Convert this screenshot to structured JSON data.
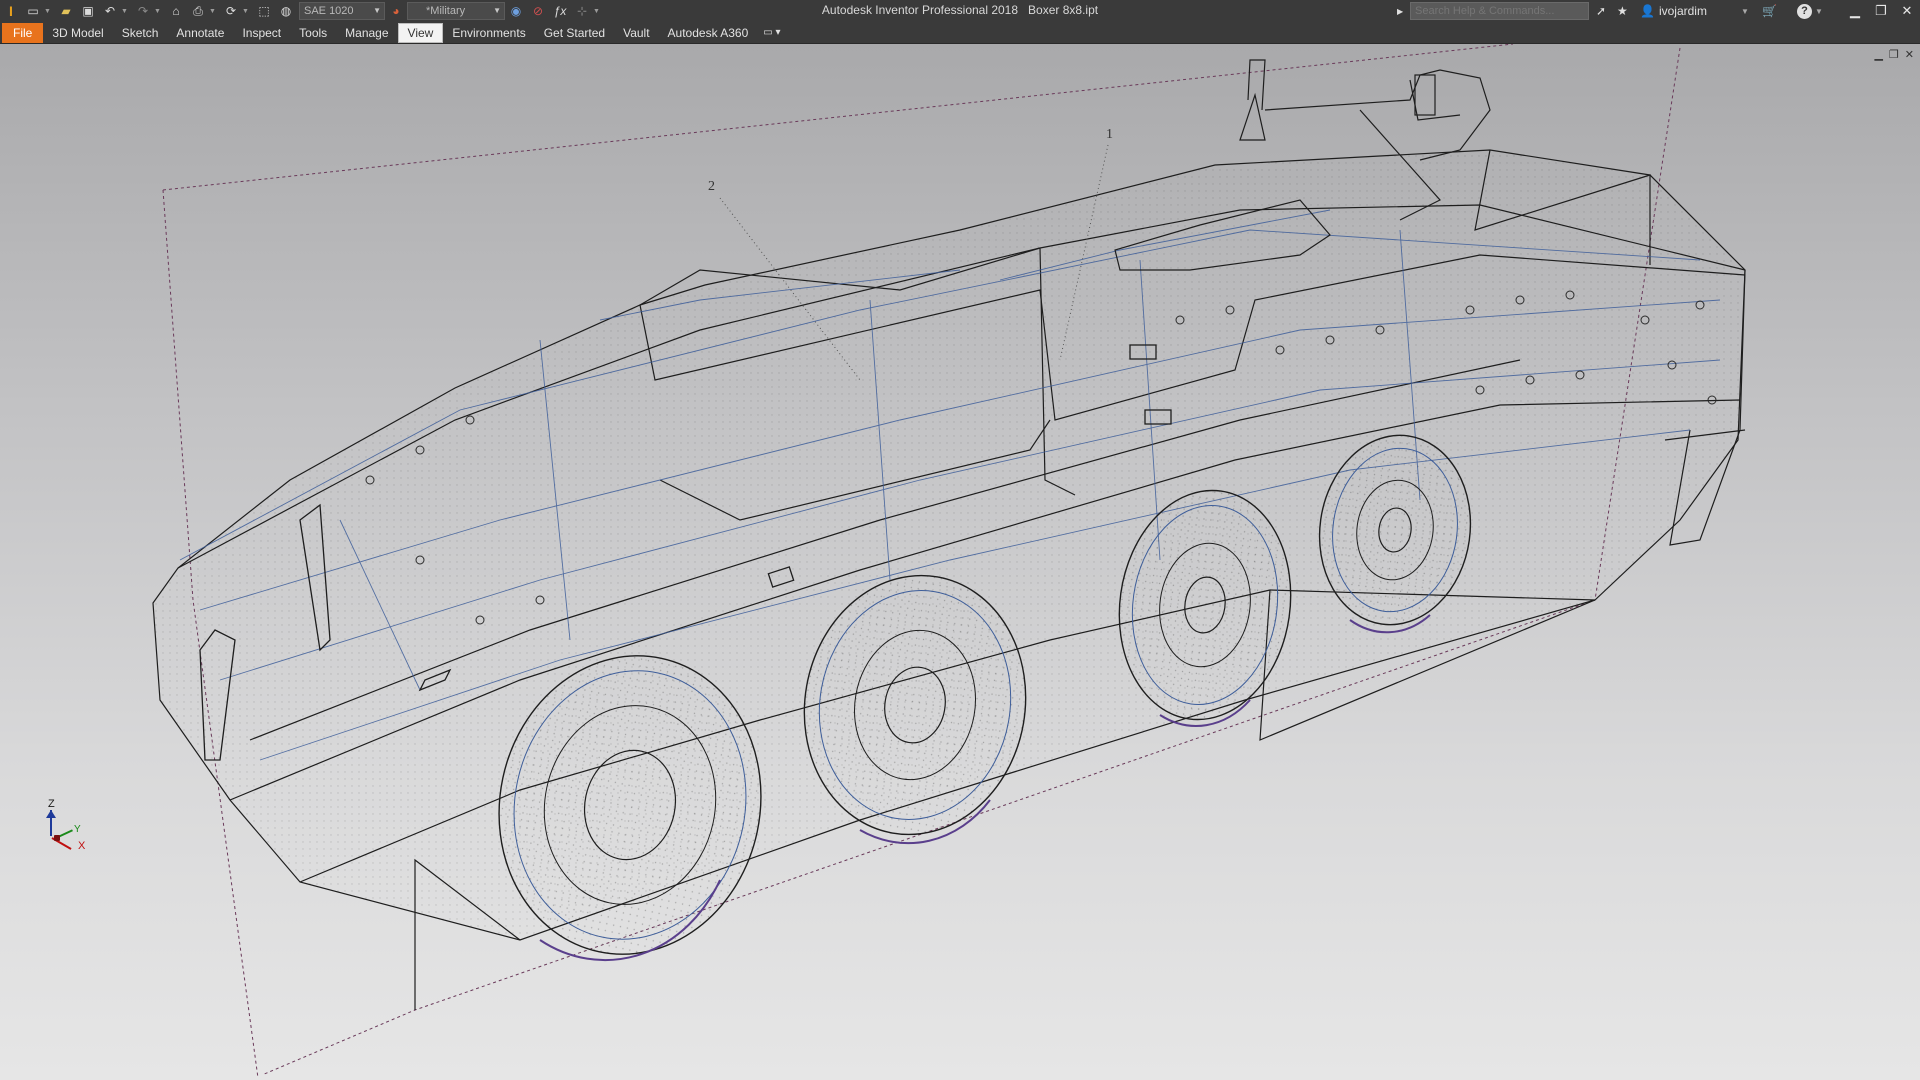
{
  "title": {
    "app_name": "Autodesk Inventor Professional 2018",
    "document": "Boxer 8x8.ipt"
  },
  "quick_access": {
    "material": "SAE 1020",
    "appearance": "*Military"
  },
  "search": {
    "placeholder": "Search Help & Commands..."
  },
  "user": {
    "name": "ivojardim"
  },
  "ribbon": {
    "tabs": [
      {
        "label": "File"
      },
      {
        "label": "3D Model"
      },
      {
        "label": "Sketch"
      },
      {
        "label": "Annotate"
      },
      {
        "label": "Inspect"
      },
      {
        "label": "Tools"
      },
      {
        "label": "Manage"
      },
      {
        "label": "View"
      },
      {
        "label": "Environments"
      },
      {
        "label": "Get Started"
      },
      {
        "label": "Vault"
      },
      {
        "label": "Autodesk A360"
      }
    ],
    "active_tab": "View"
  },
  "viewport": {
    "callouts": [
      "1",
      "2"
    ],
    "axis_labels": {
      "z": "Z",
      "y": "Y",
      "x": "X"
    },
    "render_style": "wireframe",
    "model": "Boxer 8x8 armored vehicle"
  },
  "colors": {
    "accent": "#e8731d",
    "titlebar": "#3a3a3a",
    "edge_black": "#1e1e1e",
    "edge_blue": "#3e5e9a",
    "tire_rim": "#5a3f8c"
  }
}
